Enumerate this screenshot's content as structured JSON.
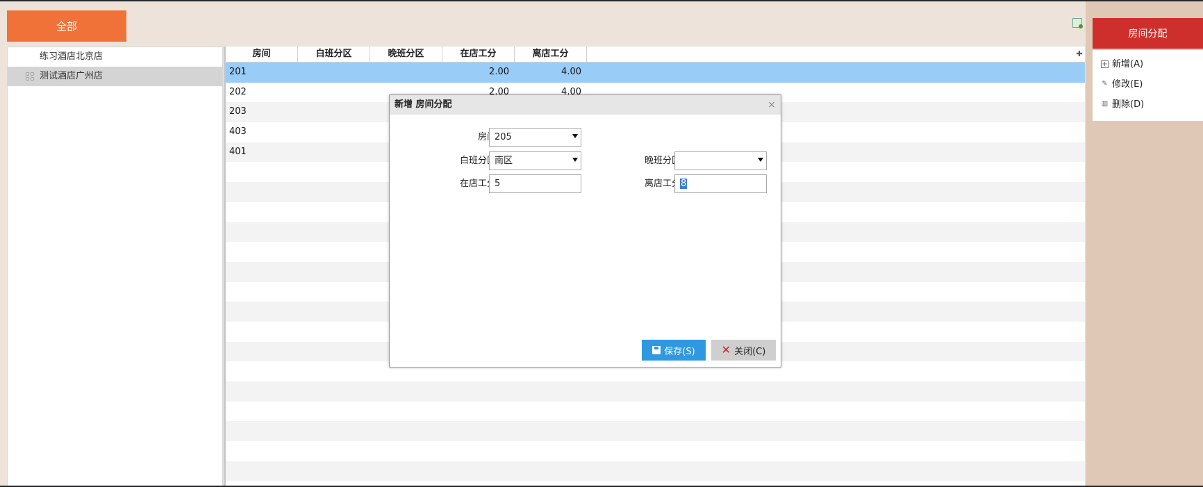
{
  "top": {
    "all_label": "全部"
  },
  "tree": {
    "items": [
      {
        "label": "练习酒店北京店",
        "selected": false
      },
      {
        "label": "测试酒店广州店",
        "selected": true
      }
    ]
  },
  "grid": {
    "columns": [
      "房间",
      "白班分区",
      "晚班分区",
      "在店工分",
      "离店工分"
    ],
    "rows": [
      {
        "room": "201",
        "day": "",
        "night": "",
        "in_score": "2.00",
        "out_score": "4.00"
      },
      {
        "room": "202",
        "day": "",
        "night": "",
        "in_score": "2.00",
        "out_score": "4.00"
      },
      {
        "room": "203",
        "day": "",
        "night": "",
        "in_score": "",
        "out_score": ""
      },
      {
        "room": "403",
        "day": "",
        "night": "",
        "in_score": "",
        "out_score": ""
      },
      {
        "room": "401",
        "day": "",
        "night": "",
        "in_score": "",
        "out_score": ""
      }
    ],
    "add_column_icon": "plus-icon"
  },
  "right_panel": {
    "title": "房间分配",
    "menu": [
      {
        "label": "新增(A)",
        "icon": "add-icon"
      },
      {
        "label": "修改(E)",
        "icon": "edit-icon"
      },
      {
        "label": "删除(D)",
        "icon": "trash-icon"
      }
    ]
  },
  "modal": {
    "title": "新增 房间分配",
    "close_glyph": "×",
    "room_label": "房间",
    "room_value": "205",
    "day_zone_label": "白班分区",
    "day_zone_value": "南区",
    "night_zone_label": "晚班分区",
    "night_zone_value": "",
    "in_score_label": "在店工分",
    "in_score_value": "5",
    "out_score_label": "离店工分",
    "out_score_value": "8",
    "save_label": "保存(S)",
    "close_label": "关闭(C)"
  },
  "colors": {
    "all_button": "#f07238",
    "panel_title": "#cf2f2c",
    "selected_row": "#99ccf7",
    "save_button": "#2e98e0"
  }
}
